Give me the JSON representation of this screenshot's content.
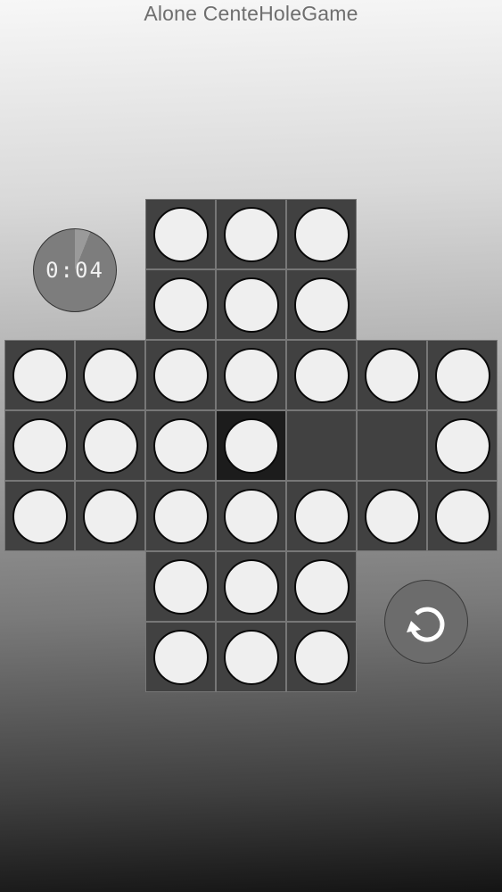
{
  "header": {
    "title": "Alone CenteHoleGame"
  },
  "timer": {
    "text": "0:04",
    "elapsed_fraction": 0.06
  },
  "board": {
    "layout": [
      "..XXX..",
      "..XXX..",
      "XXXXXXX",
      "XXXS..X",
      "XXXXXXX",
      "..XXX..",
      "..XXX.."
    ],
    "legend": {
      "X": "peg",
      "S": "selected peg",
      ".": "empty hole (or off-board in corners)"
    },
    "pegs_remaining": 30
  },
  "controls": {
    "reset_icon": "restart-icon"
  },
  "colors": {
    "cell": "#414141",
    "cell_selected": "#1c1c1c",
    "peg": "#efefef",
    "button": "#6c6c6c",
    "timer_bg": "#7d7d7d"
  }
}
